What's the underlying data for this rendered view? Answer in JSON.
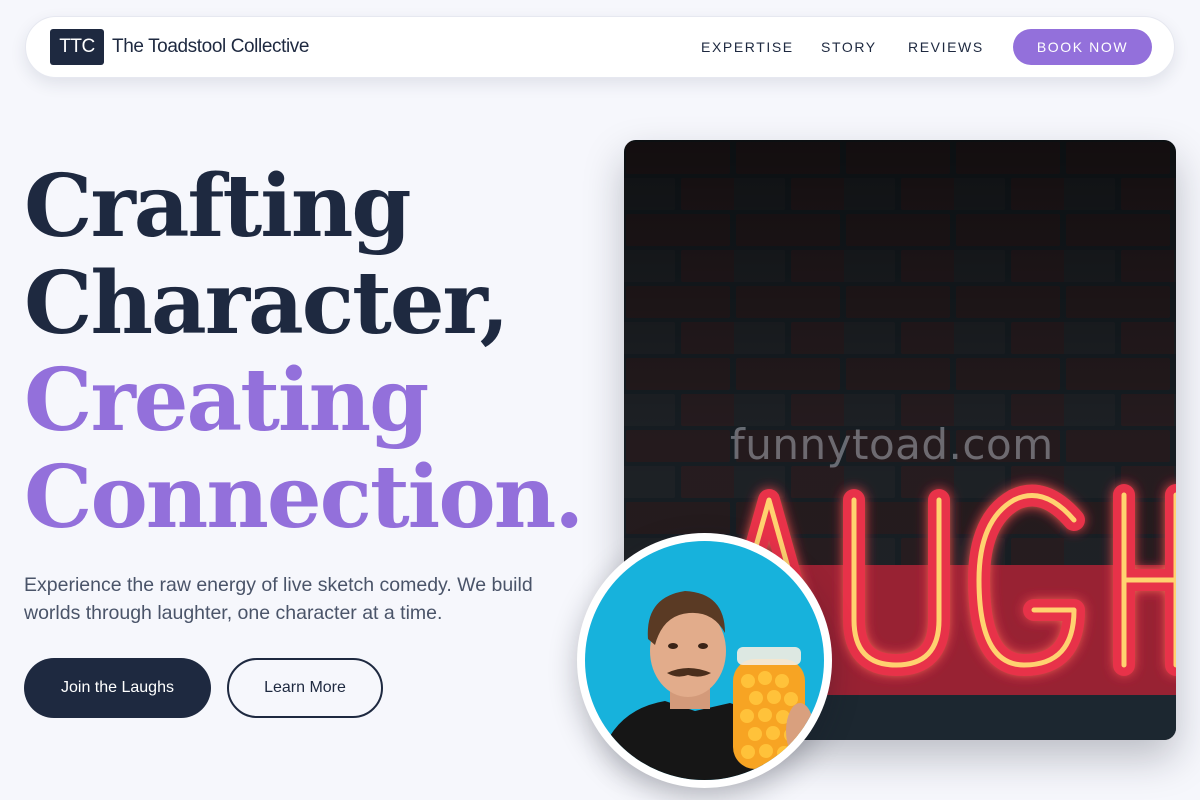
{
  "nav": {
    "logo_text": "TTC",
    "brand": "The Toadstool Collective",
    "links": [
      "EXPERTISE",
      "STORY",
      "REVIEWS"
    ],
    "cta": "BOOK NOW"
  },
  "hero": {
    "headline": {
      "line1": "Crafting",
      "line2": "Character,",
      "line3": "Creating",
      "line4": "Connection."
    },
    "subtext": "Experience the raw energy of live sketch comedy. We build worlds through laughter, one character at a time.",
    "primary_button": "Join the Laughs",
    "secondary_button": "Learn More"
  },
  "image": {
    "neon_sign": "AUGH",
    "watermark": "funnytoad.com"
  },
  "colors": {
    "primary": "#1e2940",
    "accent": "#9370db",
    "background": "#f6f7fc"
  }
}
